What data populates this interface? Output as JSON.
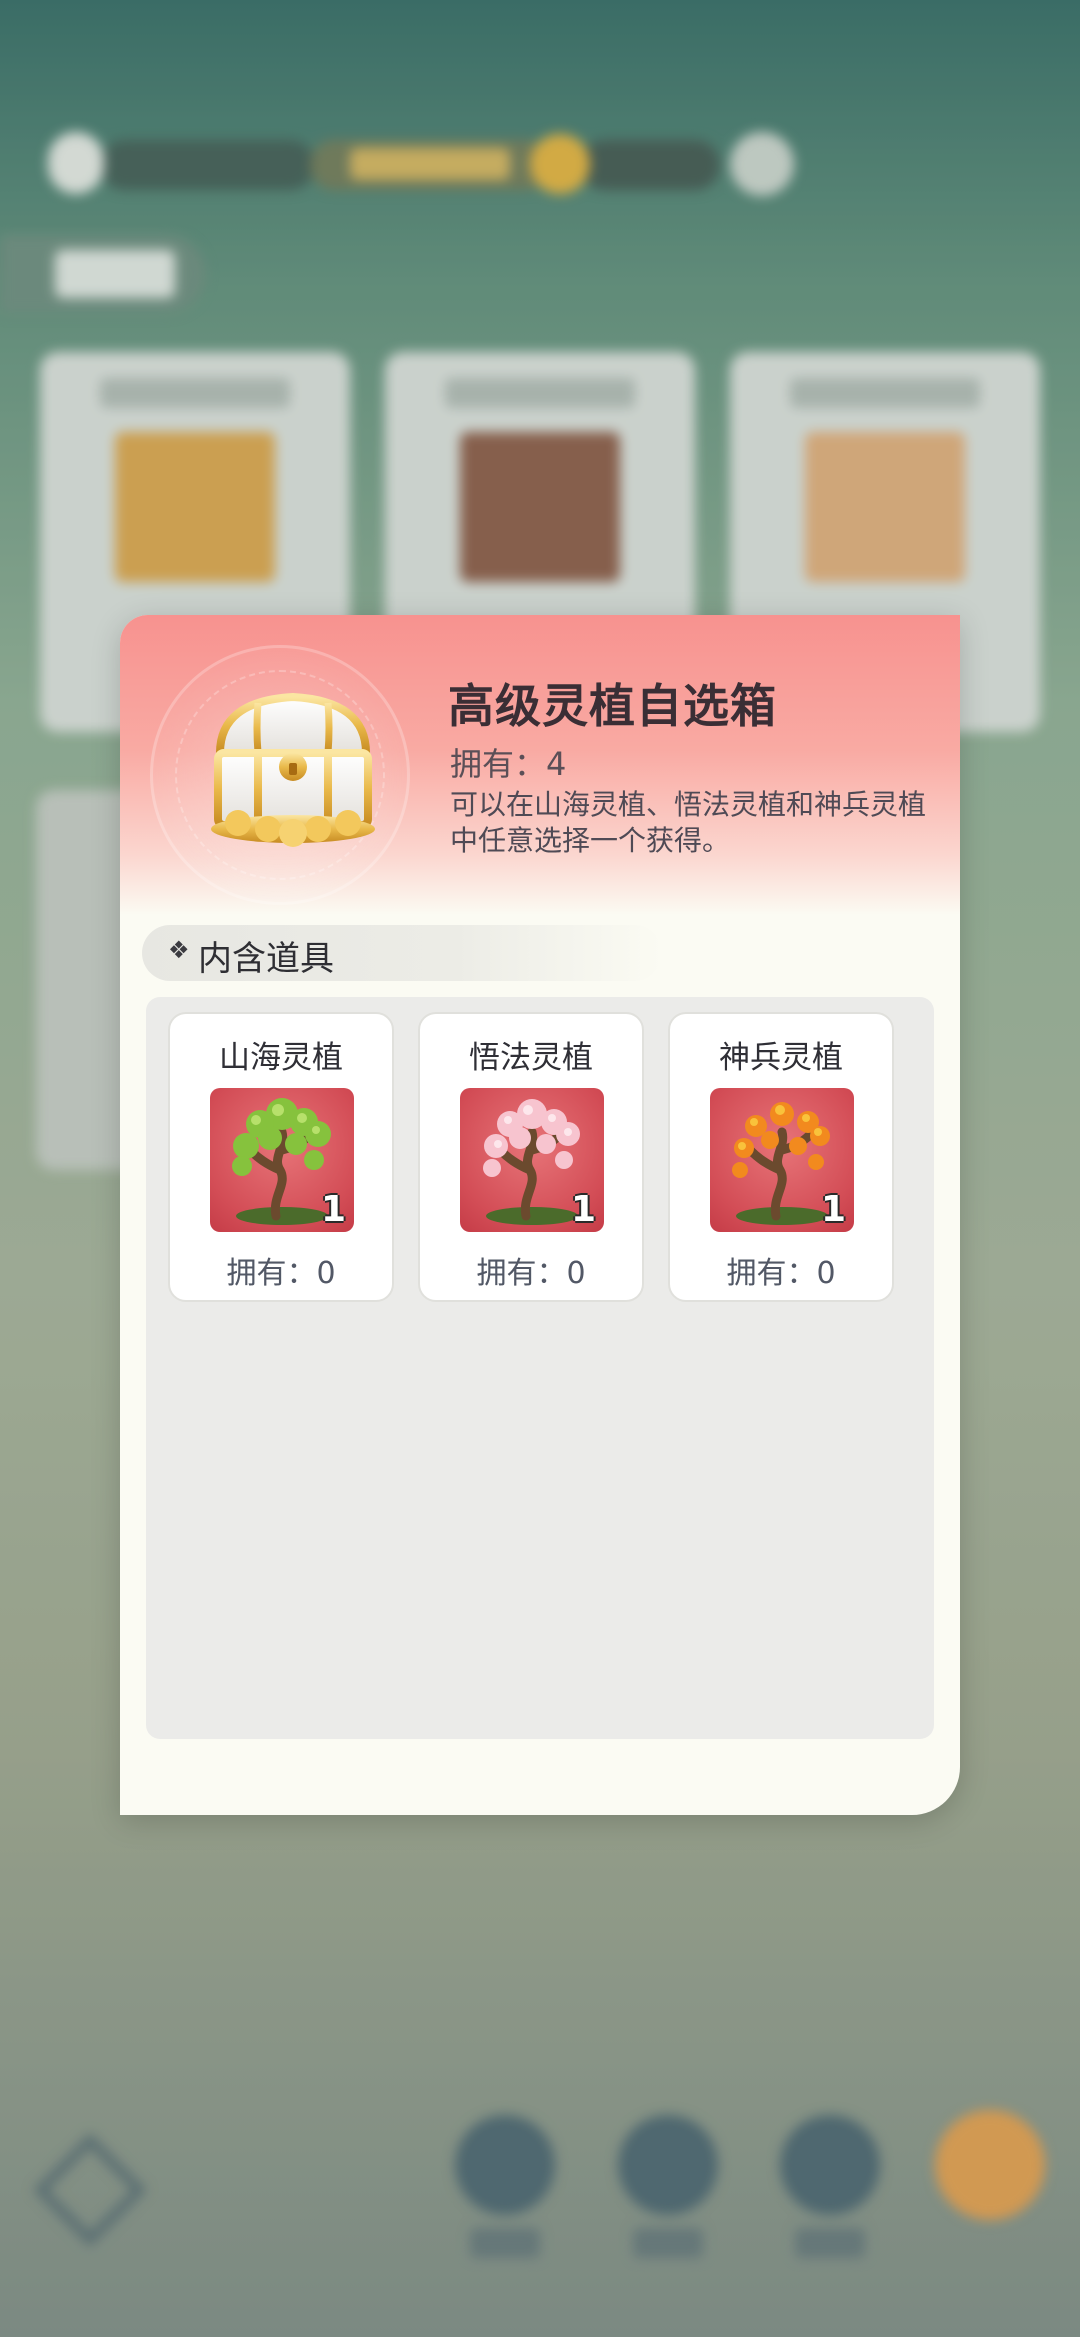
{
  "popup": {
    "title": "高级灵植自选箱",
    "owned": "拥有：4",
    "description": "可以在山海灵植、悟法灵植和神兵灵植中任意选择一个获得。",
    "icon": "treasure-chest-icon"
  },
  "contents": {
    "section_title": "内含道具",
    "items": [
      {
        "name": "山海灵植",
        "quantity": "1",
        "owned": "拥有：0",
        "icon": "green-bonsai-tree-icon",
        "leaf_color": "#7fbf3a"
      },
      {
        "name": "悟法灵植",
        "quantity": "1",
        "owned": "拥有：0",
        "icon": "pink-blossom-tree-icon",
        "leaf_color": "#f4b6c3"
      },
      {
        "name": "神兵灵植",
        "quantity": "1",
        "owned": "拥有：0",
        "icon": "orange-maple-tree-icon",
        "leaf_color": "#f07a1c"
      }
    ]
  },
  "colors": {
    "header_top": "#f7928f",
    "tile_background": "#d34d56",
    "panel_background": "#fbfbf3"
  }
}
